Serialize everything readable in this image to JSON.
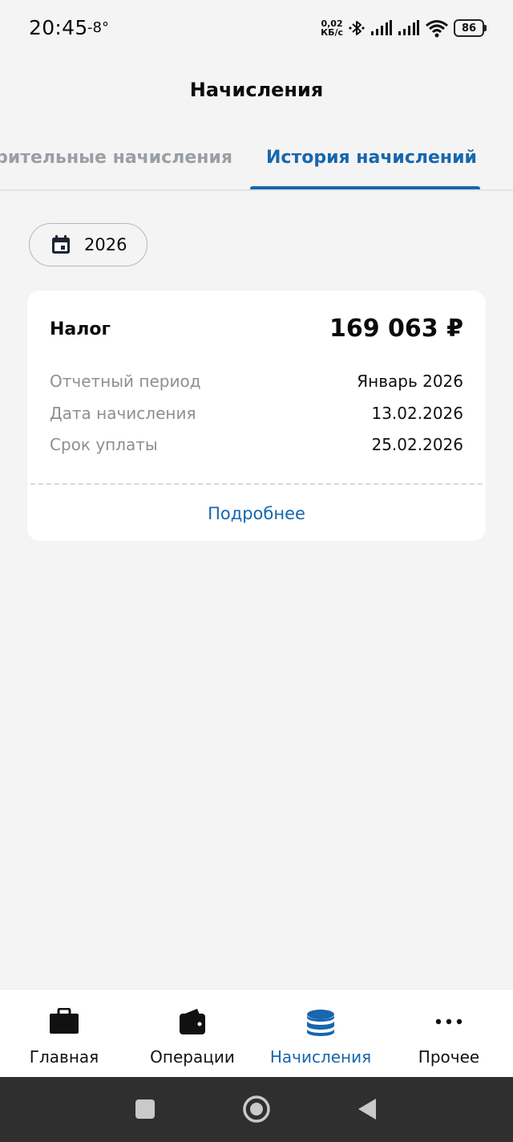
{
  "status_bar": {
    "time": "20:45",
    "temperature": "-8°",
    "net_speed_value": "0,02",
    "net_speed_unit": "КБ/с",
    "battery": "86"
  },
  "header": {
    "title": "Начисления"
  },
  "tabs": [
    {
      "label": "Предварительные начисления",
      "active": false
    },
    {
      "label": "История начислений",
      "active": true
    }
  ],
  "filter": {
    "year": "2026",
    "icon": "calendar-icon"
  },
  "charge_card": {
    "title": "Налог",
    "amount": "169 063 ₽",
    "rows": [
      {
        "label": "Отчетный период",
        "value": "Январь 2026"
      },
      {
        "label": "Дата начисления",
        "value": "13.02.2026"
      },
      {
        "label": "Срок уплаты",
        "value": "25.02.2026"
      }
    ],
    "more_link": "Подробнее"
  },
  "bottom_nav": [
    {
      "label": "Главная",
      "icon": "briefcase-icon",
      "active": false
    },
    {
      "label": "Операции",
      "icon": "wallet-icon",
      "active": false
    },
    {
      "label": "Начисления",
      "icon": "coins-stack-icon",
      "active": true
    },
    {
      "label": "Прочее",
      "icon": "more-dots-icon",
      "active": false
    }
  ],
  "colors": {
    "accent": "#1766ae",
    "background": "#f4f4f4",
    "muted_text": "#8e8f93"
  }
}
